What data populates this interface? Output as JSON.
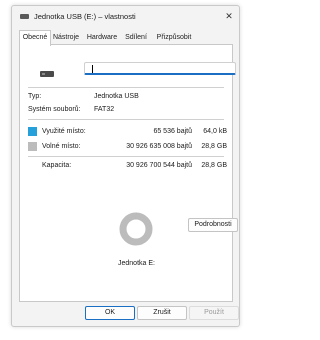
{
  "window": {
    "title": "Jednotka USB (E:) – vlastnosti",
    "close_glyph": "✕"
  },
  "tabs": [
    {
      "label": "Obecné",
      "active": true
    },
    {
      "label": "Nástroje",
      "active": false
    },
    {
      "label": "Hardware",
      "active": false
    },
    {
      "label": "Sdílení",
      "active": false
    },
    {
      "label": "Přizpůsobit",
      "active": false
    }
  ],
  "general": {
    "name_value": "",
    "type_label": "Typ:",
    "type_value": "Jednotka USB",
    "fs_label": "Systém souborů:",
    "fs_value": "FAT32",
    "used": {
      "label": "Využité místo:",
      "bytes": "65 536 bajtů",
      "size": "64,0 kB",
      "color": "#26a0da"
    },
    "free": {
      "label": "Volné místo:",
      "bytes": "30 926 635 008 bajtů",
      "size": "28,8 GB",
      "color": "#bcbcbc"
    },
    "capacity": {
      "label": "Kapacita:",
      "bytes": "30 926 700 544 bajtů",
      "size": "28,8 GB"
    },
    "used_fraction": 2.1e-06,
    "drive_label": "Jednotka E:",
    "details_button": "Podrobnosti"
  },
  "footer": {
    "ok": "OK",
    "cancel": "Zrušit",
    "apply": "Použít"
  },
  "icons": {
    "drive": "usb-drive-icon"
  }
}
